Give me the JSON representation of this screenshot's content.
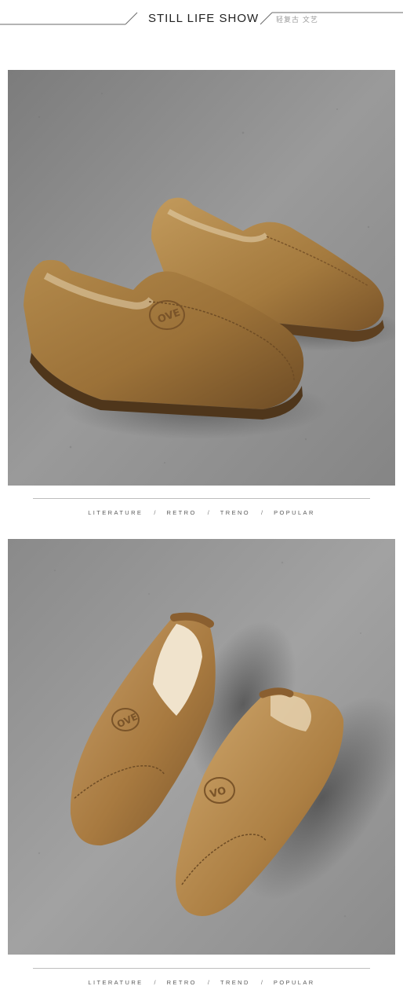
{
  "header": {
    "title": "STILL LIFE SHOW",
    "subtitle": "轻复古 文艺"
  },
  "taglines": [
    {
      "words": [
        "LITERATURE",
        "RETRO",
        "TRENO",
        "POPULAR"
      ],
      "separator": "/"
    },
    {
      "words": [
        "LITERATURE",
        "RETRO",
        "TREND",
        "POPULAR"
      ],
      "separator": "/"
    }
  ],
  "colors": {
    "leather": "#9b7138",
    "leather_light": "#c29a5c",
    "leather_dark": "#5e4020",
    "background_concrete": "#8f8f8f",
    "rule": "#bdbdbd"
  }
}
